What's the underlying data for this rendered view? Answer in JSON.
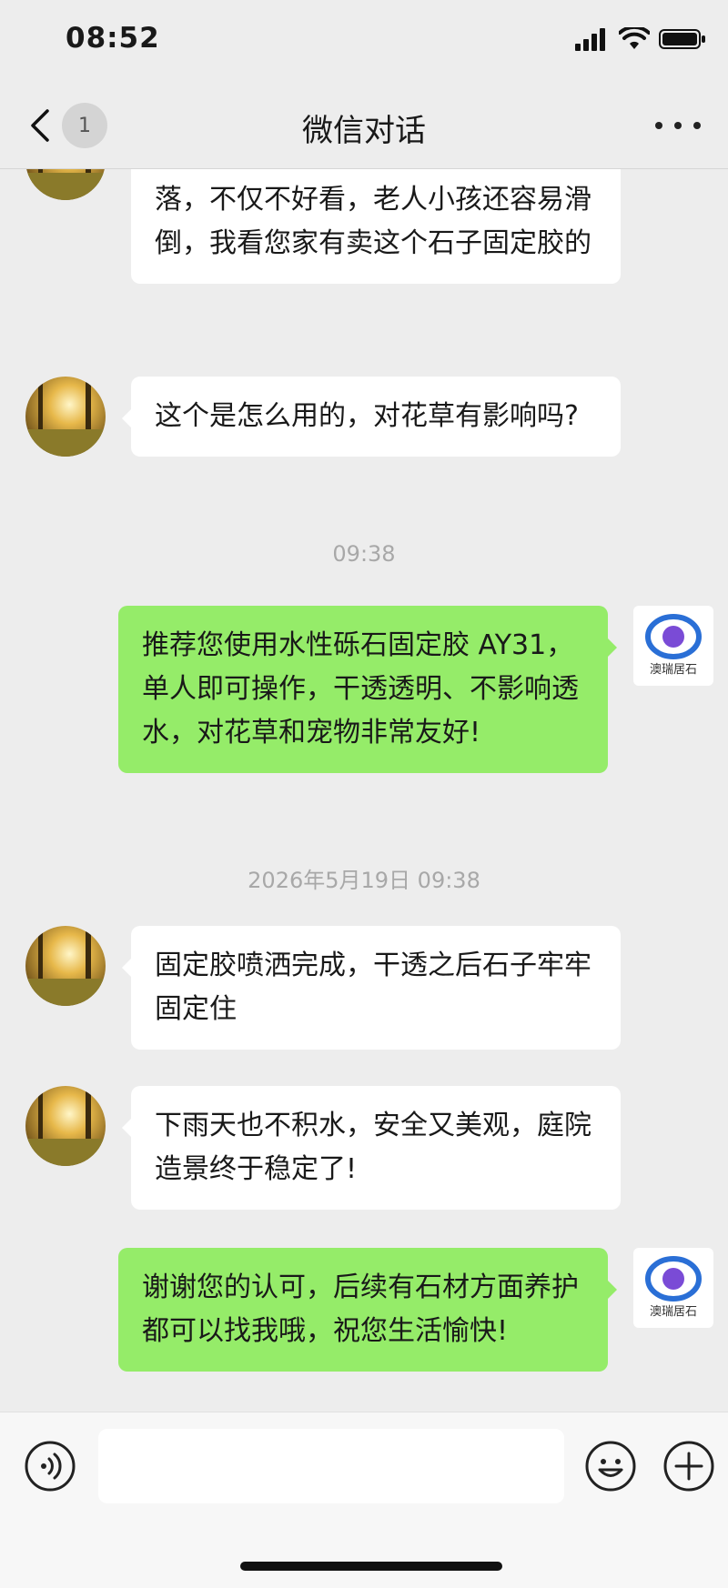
{
  "status_bar": {
    "time": "08:52"
  },
  "nav": {
    "back_badge": "1",
    "title": "微信对话"
  },
  "messages": [
    {
      "text": "院子造景的小石子总被踩得移位、散落，不仅不好看，老人小孩还容易滑倒，我看您家有卖这个石子固定胶的"
    },
    {
      "text": "这个是怎么用的，对花草有影响吗?"
    },
    {
      "timestamp": "09:38"
    },
    {
      "text": "推荐您使用水性砾石固定胶 AY31，单人即可操作，干透透明、不影响透水，对花草和宠物非常友好!",
      "logo_text": "澳瑞居石"
    },
    {
      "timestamp": "2026年5月19日 09:38"
    },
    {
      "text": "固定胶喷洒完成，干透之后石子牢牢固定住"
    },
    {
      "text": "下雨天也不积水，安全又美观，庭院造景终于稳定了!"
    },
    {
      "text": "谢谢您的认可，后续有石材方面养护都可以找我哦，祝您生活愉快!",
      "logo_text": "澳瑞居石"
    }
  ],
  "input": {
    "value": "",
    "placeholder": ""
  },
  "colors": {
    "background": "#ededed",
    "bubble_self": "#95ec69",
    "bubble_other": "#ffffff"
  },
  "icons": [
    "signal-icon",
    "wifi-icon",
    "battery-icon",
    "back-chevron-icon",
    "more-icon",
    "voice-icon",
    "emoji-icon",
    "plus-icon"
  ]
}
